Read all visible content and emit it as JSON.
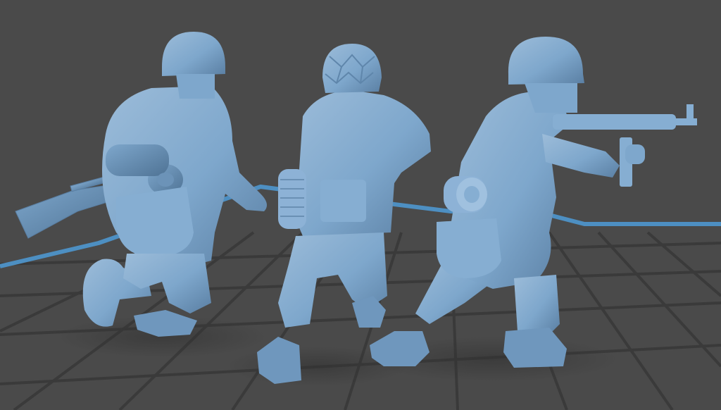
{
  "viewport": {
    "background": "#4a4a4a",
    "grid_color": "#3a3a3a",
    "build_plate_edge_color": "#4d8fc2",
    "model_color": "#7ea7cc",
    "model_shadow_color": "#5f86ab",
    "model_highlight_color": "#a7c6e2"
  },
  "models": [
    {
      "name": "soldier-rifle-kneeling"
    },
    {
      "name": "soldier-net-helmet-back"
    },
    {
      "name": "soldier-smg-aiming"
    }
  ]
}
